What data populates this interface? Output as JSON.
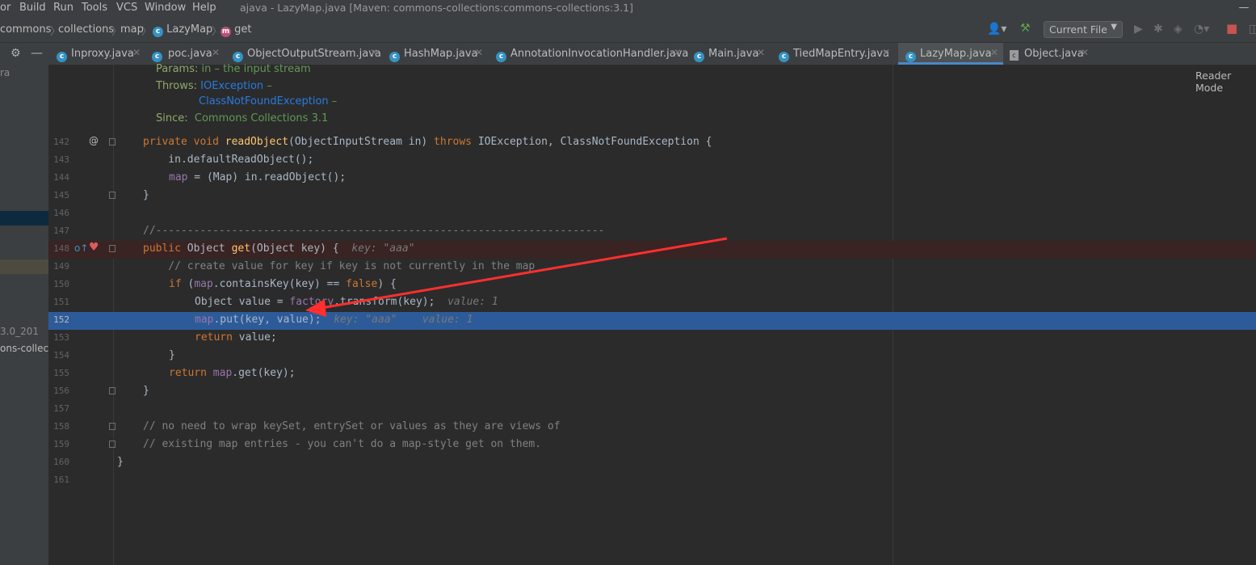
{
  "menu": {
    "items": [
      "or",
      "Build",
      "Run",
      "Tools",
      "VCS",
      "Window",
      "Help"
    ],
    "title": "ajava - LazyMap.java [Maven: commons-collections:commons-collections:3.1]"
  },
  "breadcrumb": {
    "items": [
      "commons",
      "collections",
      "map",
      "LazyMap",
      "get"
    ]
  },
  "toolbar": {
    "run_config": "Current File"
  },
  "tabs": [
    {
      "label": "Inproxy.java"
    },
    {
      "label": "poc.java"
    },
    {
      "label": "ObjectOutputStream.java"
    },
    {
      "label": "HashMap.java"
    },
    {
      "label": "AnnotationInvocationHandler.java"
    },
    {
      "label": "Main.java"
    },
    {
      "label": "TiedMapEntry.java"
    },
    {
      "label": "LazyMap.java"
    },
    {
      "label": "Object.java"
    }
  ],
  "left_panel": {
    "fragment1": "ra",
    "fragment2": "3.0_201",
    "fragment3": "ons-collect"
  },
  "editor": {
    "reader_mode": "Reader Mode",
    "doc": {
      "params_label": "Params:",
      "params_text": "in – the input stream",
      "throws_label": "Throws:",
      "throws1": "IOException",
      "throws2": "ClassNotFoundException",
      "dash": "–",
      "since_label": "Since:",
      "since_text": "Commons Collections 3.1"
    },
    "line_numbers": [
      "142",
      "143",
      "144",
      "145",
      "146",
      "147",
      "148",
      "149",
      "150",
      "151",
      "152",
      "153",
      "154",
      "155",
      "156",
      "157",
      "158",
      "159",
      "160",
      "161"
    ],
    "lines": {
      "l142_a": "private void ",
      "l142_fn": "readObject",
      "l142_b": "(ObjectInputStream in) ",
      "l142_kw": "throws",
      "l142_c": " IOException, ClassNotFoundException {",
      "l143": "    in.defaultReadObject();",
      "l144_fld": "map",
      "l144_rest": " = (Map) in.readObject();",
      "l145": "}",
      "l147": "//-----------------------------------------------------------------------",
      "l148_kw": "public",
      "l148_a": " Object ",
      "l148_fn": "get",
      "l148_b": "(Object key) {  ",
      "l148_hint": "key: \"aaa\"",
      "l149": "    // create value for key if key is not currently in the map",
      "l150_kw": "if",
      "l150_a": " (",
      "l150_fld": "map",
      "l150_b": ".containsKey(key) == ",
      "l150_kw2": "false",
      "l150_c": ") {",
      "l151_a": "Object value = ",
      "l151_fld": "factory",
      "l151_b": ".transform(key);  ",
      "l151_hint": "value: 1",
      "l152_fld": "map",
      "l152_a": ".put(key, value);  ",
      "l152_hint1": "key: \"aaa\"",
      "l152_hint2": "value: 1",
      "l153_kw": "return",
      "l153_a": " value;",
      "l154": "}",
      "l155_kw": "return",
      "l155_fld": "map",
      "l155_a": ".get(key);",
      "l156": "}",
      "l158": "// no need to wrap keySet, entrySet or values as they are views of",
      "l159": "// existing map entries - you can't do a map-style get on them.",
      "l160": "}"
    }
  },
  "colors": {
    "editor_bg": "#2b2b2b",
    "keyword": "#cc7832",
    "function": "#ffc66d",
    "field": "#9876aa",
    "comment": "#808080",
    "selection": "#2d5b9a",
    "arrow": "#ff2f2f"
  }
}
